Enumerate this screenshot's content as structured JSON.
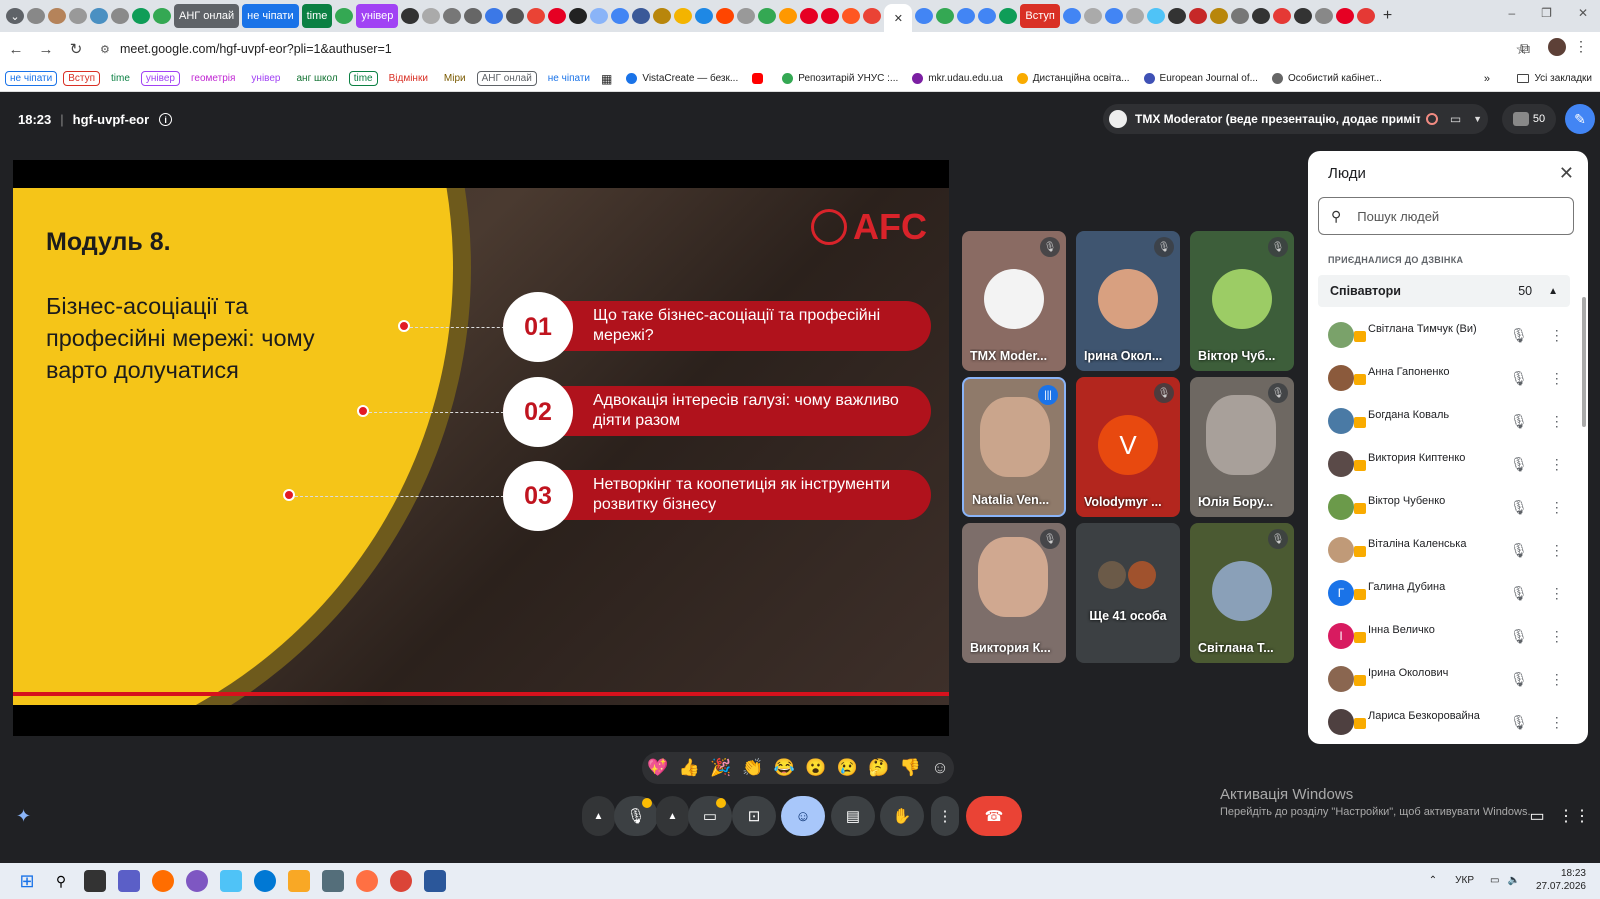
{
  "browser": {
    "url": "meet.google.com/hgf-uvpf-eor?pli=1&authuser=1",
    "tabs": [
      {
        "label": "АНГ онлай",
        "color": "#5f6368"
      },
      {
        "label": "не чіпати",
        "color": "#1a73e8"
      },
      {
        "label": "time",
        "color": "#0b8043"
      },
      {
        "label": "універ",
        "color": "#a142f4"
      },
      {
        "label": "Вступ",
        "color": "#d93025"
      }
    ],
    "bookmarks_chips": [
      "не чіпати",
      "Вступ",
      "time",
      "універ",
      "геометрія",
      "універ",
      "анг школ",
      "time",
      "Відмінки",
      "Міри",
      "АНГ онлай",
      "не чіпати"
    ],
    "bookmarks": [
      "VistaCreate — безк...",
      "Репозитарій УНУС :...",
      "mkr.udau.edu.ua",
      "Дистанційна освіта...",
      "European Journal of...",
      "Особистий кабінет..."
    ],
    "all_bookmarks": "Усі закладки"
  },
  "meet": {
    "time": "18:23",
    "code": "hgf-uvpf-eor",
    "presenter": "TMX Moderator (веде презентацію, додає примітки)",
    "participant_count": "50"
  },
  "slide": {
    "title": "Модуль 8.",
    "subtitle": "Бізнес-асоціації та професійні мережі: чому варто долучатися",
    "logo": "AFC",
    "items": [
      {
        "num": "01",
        "text": "Що таке бізнес-асоціації та професійні мережі?"
      },
      {
        "num": "02",
        "text": "Адвокація інтересів галузі: чому важливо діяти разом"
      },
      {
        "num": "03",
        "text": "Нетворкінг та коопетиція як інструменти розвитку бізнесу"
      }
    ]
  },
  "tiles": [
    {
      "name": "TMX Moder...",
      "bg": "#8a6b63"
    },
    {
      "name": "Ірина Окол...",
      "bg": "#3f5570"
    },
    {
      "name": "Віктор Чуб...",
      "bg": "#3d5e3a"
    },
    {
      "name": "Natalia Ven...",
      "bg": "#8f7a6a"
    },
    {
      "name": "Volodymyr ...",
      "bg": "#b3261e"
    },
    {
      "name": "Юлія Бору...",
      "bg": "#6e6862"
    },
    {
      "name": "Виктория К...",
      "bg": "#7d6e6a"
    },
    {
      "name": "Ще 41 особа",
      "bg": "#3c4043"
    },
    {
      "name": "Світлана Т...",
      "bg": "#4b5a32"
    }
  ],
  "volodymyr_initial": "V",
  "people_panel": {
    "title": "Люди",
    "search_placeholder": "Пошук людей",
    "joined_label": "ПРИЄДНАЛИСЯ ДО ДЗВІНКА",
    "group_label": "Співавтори",
    "group_count": "50",
    "people": [
      {
        "name": "Світлана Тимчук (Ви)",
        "avatar": "#7aa26a",
        "initial": ""
      },
      {
        "name": "Анна Гапоненко",
        "avatar": "#8b5a3c",
        "initial": ""
      },
      {
        "name": "Богдана Коваль",
        "avatar": "#4a7aa5",
        "initial": ""
      },
      {
        "name": "Виктория Киптенко",
        "avatar": "#5a4a48",
        "initial": ""
      },
      {
        "name": "Віктор Чубенко",
        "avatar": "#6b9a4a",
        "initial": ""
      },
      {
        "name": "Віталіна Каленська",
        "avatar": "#c09a78",
        "initial": ""
      },
      {
        "name": "Галина Дубина",
        "avatar": "#1a73e8",
        "initial": "Г"
      },
      {
        "name": "Інна Величко",
        "avatar": "#d81b60",
        "initial": "І"
      },
      {
        "name": "Ірина Околович",
        "avatar": "#8a6650",
        "initial": ""
      },
      {
        "name": "Лариса Безкоровайна",
        "avatar": "#4e4040",
        "initial": ""
      }
    ]
  },
  "reactions": [
    "💖",
    "👍",
    "🎉",
    "👏",
    "😂",
    "😮",
    "😢",
    "🤔",
    "👎",
    "☺"
  ],
  "watermark": {
    "title": "Активація Windows",
    "subtitle": "Перейдіть до розділу \"Настройки\", щоб активувати Windows."
  },
  "taskbar": {
    "lang": "УКР",
    "time": "18:23",
    "date": "27.07.2026"
  }
}
